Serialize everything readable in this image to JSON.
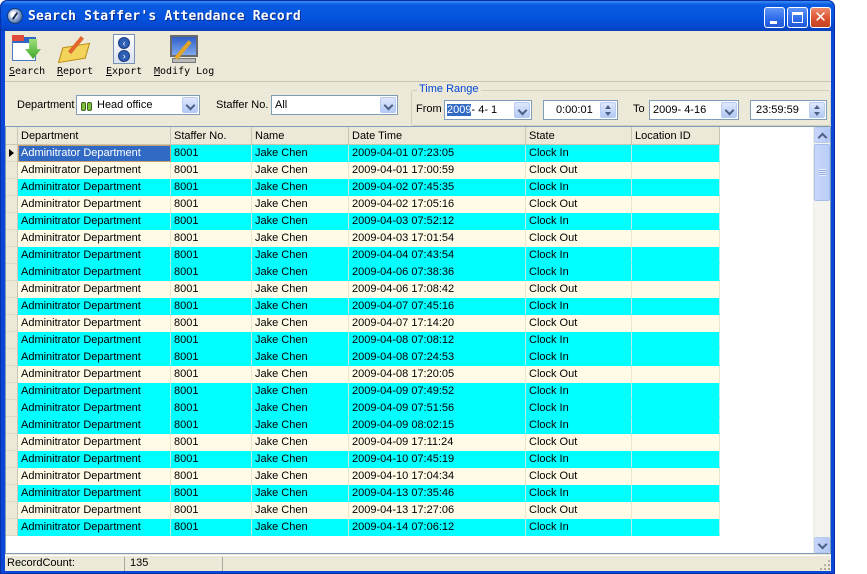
{
  "window": {
    "title": "Search Staffer's Attendance Record",
    "controls": {
      "minimize": "minimize",
      "maximize": "maximize",
      "close": "close"
    }
  },
  "toolbar": {
    "items": [
      {
        "id": "search",
        "label_hotkey": "S",
        "label_rest": "earch",
        "icon": "search-records-icon"
      },
      {
        "id": "report",
        "label_hotkey": "R",
        "label_rest": "eport",
        "icon": "report-icon"
      },
      {
        "id": "export",
        "label_hotkey": "E",
        "label_rest": "xport",
        "icon": "export-icon"
      },
      {
        "id": "modify_log",
        "label_hotkey": "M",
        "label_rest": "odify Log",
        "icon": "modify-log-icon"
      }
    ]
  },
  "filters": {
    "department_label": "Department",
    "department_value": "Head office",
    "staffer_label": "Staffer No.",
    "staffer_value": "All",
    "time_range": {
      "legend": "Time Range",
      "from_label": "From",
      "from_date_selected": "2009",
      "from_date_rest": "- 4- 1",
      "from_time": "0:00:01",
      "to_label": "To",
      "to_date": "2009- 4-16",
      "to_time": "23:59:59"
    }
  },
  "grid": {
    "columns": [
      "Department",
      "Staffer No.",
      "Name",
      "Date Time",
      "State",
      "Location ID"
    ],
    "colors": {
      "clock_in": "#00ffff",
      "clock_out": "#fffbe6",
      "selected": "#316ac5"
    },
    "rows": [
      [
        "Adminitrator Department",
        "8001",
        "Jake Chen",
        "2009-04-01 07:23:05",
        "Clock In",
        ""
      ],
      [
        "Adminitrator Department",
        "8001",
        "Jake Chen",
        "2009-04-01 17:00:59",
        "Clock Out",
        ""
      ],
      [
        "Adminitrator Department",
        "8001",
        "Jake Chen",
        "2009-04-02 07:45:35",
        "Clock In",
        ""
      ],
      [
        "Adminitrator Department",
        "8001",
        "Jake Chen",
        "2009-04-02 17:05:16",
        "Clock Out",
        ""
      ],
      [
        "Adminitrator Department",
        "8001",
        "Jake Chen",
        "2009-04-03 07:52:12",
        "Clock In",
        ""
      ],
      [
        "Adminitrator Department",
        "8001",
        "Jake Chen",
        "2009-04-03 17:01:54",
        "Clock Out",
        ""
      ],
      [
        "Adminitrator Department",
        "8001",
        "Jake Chen",
        "2009-04-04 07:43:54",
        "Clock In",
        ""
      ],
      [
        "Adminitrator Department",
        "8001",
        "Jake Chen",
        "2009-04-06 07:38:36",
        "Clock In",
        ""
      ],
      [
        "Adminitrator Department",
        "8001",
        "Jake Chen",
        "2009-04-06 17:08:42",
        "Clock Out",
        ""
      ],
      [
        "Adminitrator Department",
        "8001",
        "Jake Chen",
        "2009-04-07 07:45:16",
        "Clock In",
        ""
      ],
      [
        "Adminitrator Department",
        "8001",
        "Jake Chen",
        "2009-04-07 17:14:20",
        "Clock Out",
        ""
      ],
      [
        "Adminitrator Department",
        "8001",
        "Jake Chen",
        "2009-04-08 07:08:12",
        "Clock In",
        ""
      ],
      [
        "Adminitrator Department",
        "8001",
        "Jake Chen",
        "2009-04-08 07:24:53",
        "Clock In",
        ""
      ],
      [
        "Adminitrator Department",
        "8001",
        "Jake Chen",
        "2009-04-08 17:20:05",
        "Clock Out",
        ""
      ],
      [
        "Adminitrator Department",
        "8001",
        "Jake Chen",
        "2009-04-09 07:49:52",
        "Clock In",
        ""
      ],
      [
        "Adminitrator Department",
        "8001",
        "Jake Chen",
        "2009-04-09 07:51:56",
        "Clock In",
        ""
      ],
      [
        "Adminitrator Department",
        "8001",
        "Jake Chen",
        "2009-04-09 08:02:15",
        "Clock In",
        ""
      ],
      [
        "Adminitrator Department",
        "8001",
        "Jake Chen",
        "2009-04-09 17:11:24",
        "Clock Out",
        ""
      ],
      [
        "Adminitrator Department",
        "8001",
        "Jake Chen",
        "2009-04-10 07:45:19",
        "Clock In",
        ""
      ],
      [
        "Adminitrator Department",
        "8001",
        "Jake Chen",
        "2009-04-10 17:04:34",
        "Clock Out",
        ""
      ],
      [
        "Adminitrator Department",
        "8001",
        "Jake Chen",
        "2009-04-13 07:35:46",
        "Clock In",
        ""
      ],
      [
        "Adminitrator Department",
        "8001",
        "Jake Chen",
        "2009-04-13 17:27:06",
        "Clock Out",
        ""
      ],
      [
        "Adminitrator Department",
        "8001",
        "Jake Chen",
        "2009-04-14 07:06:12",
        "Clock In",
        ""
      ]
    ],
    "current_row": 0
  },
  "status": {
    "record_count_label": "RecordCount:",
    "record_count": "135"
  }
}
